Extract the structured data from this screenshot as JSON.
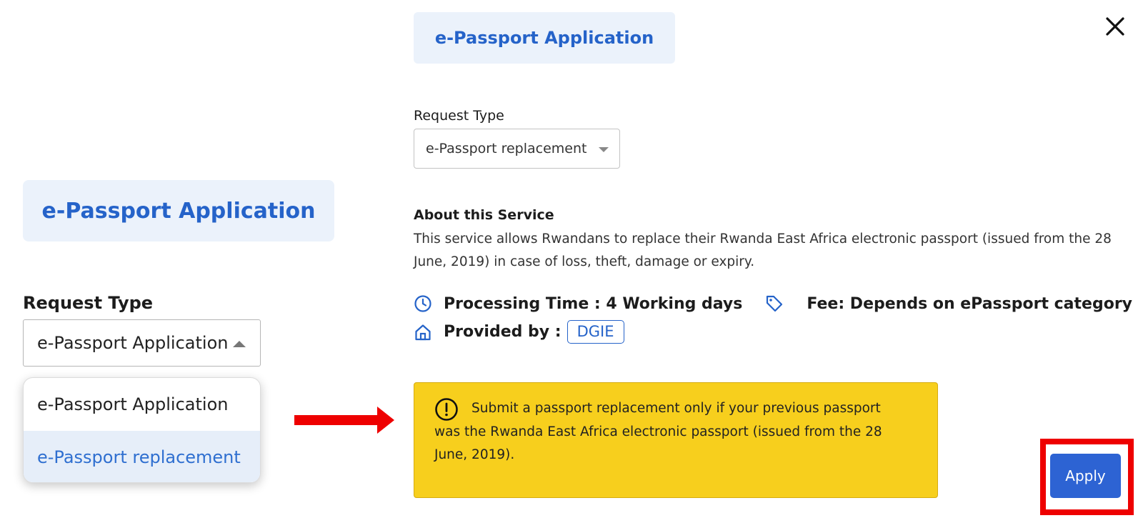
{
  "left_panel": {
    "title": "e-Passport Application",
    "request_type_label": "Request Type",
    "select_value": "e-Passport Application",
    "options": [
      {
        "label": "e-Passport Application",
        "selected": false
      },
      {
        "label": "e-Passport replacement",
        "selected": true
      }
    ]
  },
  "header": {
    "title": "e-Passport Application",
    "close_icon": "close-icon"
  },
  "form": {
    "request_type_label": "Request Type",
    "request_type_value": "e-Passport replacement"
  },
  "about": {
    "heading": "About this Service",
    "text": "This service allows Rwandans to replace their Rwanda East Africa electronic passport (issued from the 28 June, 2019) in case of loss, theft, damage or expiry."
  },
  "meta": {
    "processing_time": "Processing Time : 4 Working days",
    "fee": "Fee: Depends on ePassport category",
    "provided_by_label": "Provided by :",
    "provider": "DGIE"
  },
  "alert": {
    "message": "Submit a passport replacement only if your previous passport was the Rwanda East Africa electronic passport (issued from the 28 June, 2019)."
  },
  "actions": {
    "apply_label": "Apply"
  },
  "colors": {
    "accent": "#2563c9",
    "title_bg": "#ebf2fb",
    "alert_bg": "#f7cf1d",
    "apply_bg": "#2d63d3",
    "highlight": "#ee0000"
  }
}
